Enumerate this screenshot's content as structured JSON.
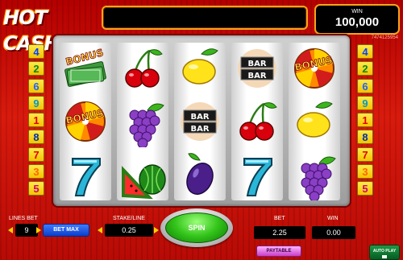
{
  "header": {
    "logo_text": "HOT CASH",
    "message": "",
    "win_label": "WIN",
    "win_value": "100,000",
    "game_id": "7474125954"
  },
  "lines_left": [
    "4",
    "2",
    "6",
    "9",
    "1",
    "8",
    "7",
    "3",
    "5"
  ],
  "lines_right": [
    "4",
    "2",
    "6",
    "9",
    "1",
    "8",
    "7",
    "3",
    "5"
  ],
  "line_colors": {
    "4": "#0044ff",
    "2": "#008a1a",
    "6": "#1a66ff",
    "9": "#0099cc",
    "1": "#e00000",
    "8": "#0033aa",
    "7": "#e00000",
    "3": "#ff6600",
    "5": "#cc0077"
  },
  "reels": [
    [
      "bonus-cash-icon",
      "bonus-wheel-icon",
      "seven-icon"
    ],
    [
      "cherries-icon",
      "grapes-icon",
      "watermelon-icon"
    ],
    [
      "lemon-icon",
      "bar-bar-icon",
      "plum-icon"
    ],
    [
      "bar-bar-icon",
      "cherries-icon",
      "seven-icon"
    ],
    [
      "bonus-wheel-icon",
      "lemon-icon",
      "grapes-icon"
    ]
  ],
  "symbol_text": {
    "bonus": "BONUS",
    "bar": "BAR"
  },
  "controls": {
    "lines_bet_label": "LINES BET",
    "lines_bet_value": "9",
    "bet_max_label": "BET MAX",
    "stake_line_label": "STAKE/LINE",
    "stake_line_value": "0.25",
    "spin_label": "SPIN",
    "bet_label": "BET",
    "bet_value": "2.25",
    "win_label": "WIN",
    "win_value": "0.00",
    "paytable_label": "PAYTABLE",
    "autoplay_label": "AUTO PLAY"
  },
  "colors": {
    "background": "#d91a0d",
    "frame_gold": "#f3a51a",
    "spin_green": "#33c41a",
    "bet_max_blue": "#1d55e0",
    "paytable_pink": "#e070e0"
  }
}
